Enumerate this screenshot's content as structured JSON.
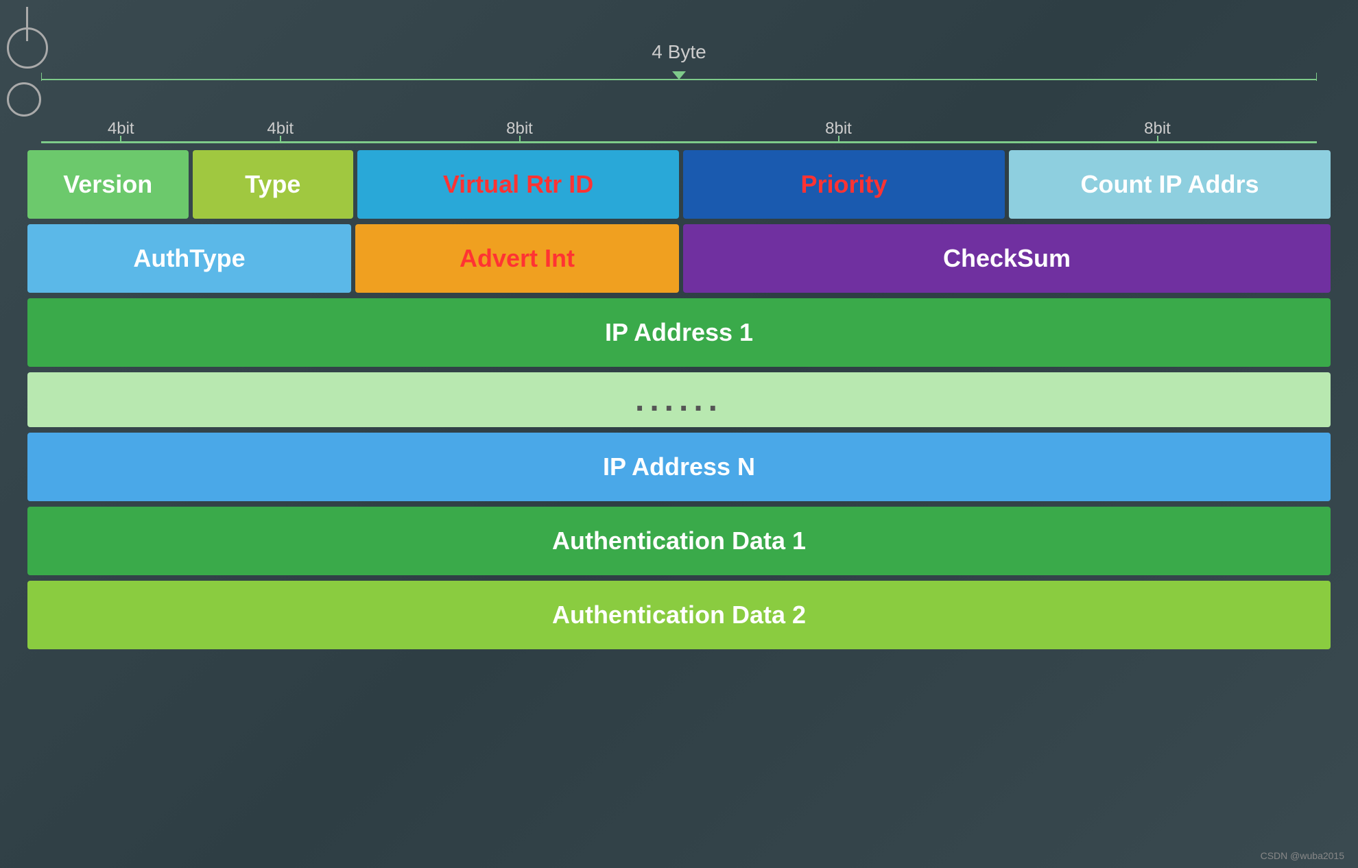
{
  "header": {
    "four_byte_label": "4 Byte",
    "bit_segments": [
      {
        "label": "4bit",
        "flex": 1
      },
      {
        "label": "4bit",
        "flex": 1
      },
      {
        "label": "8bit",
        "flex": 2
      },
      {
        "label": "8bit",
        "flex": 2
      },
      {
        "label": "8bit",
        "flex": 2
      }
    ]
  },
  "rows": [
    {
      "cells": [
        {
          "label": "Version",
          "color": "#6cc96c",
          "flex": 1,
          "textColor": "white"
        },
        {
          "label": "Type",
          "color": "#a0c840",
          "flex": 1,
          "textColor": "white"
        },
        {
          "label": "Virtual Rtr ID",
          "color": "#29a8d8",
          "flex": 2,
          "textColor": "red"
        },
        {
          "label": "Priority",
          "color": "#1a5aaf",
          "flex": 2,
          "textColor": "red"
        },
        {
          "label": "Count IP Addrs",
          "color": "#8ecfdf",
          "flex": 2,
          "textColor": "white"
        }
      ]
    },
    {
      "cells": [
        {
          "label": "AuthType",
          "color": "#5bb8e8",
          "flex": 2,
          "textColor": "white"
        },
        {
          "label": "Advert Int",
          "color": "#f0a020",
          "flex": 2,
          "textColor": "red"
        },
        {
          "label": "CheckSum",
          "color": "#7030a0",
          "flex": 4,
          "textColor": "white"
        }
      ]
    },
    {
      "cells": [
        {
          "label": "IP Address 1",
          "color": "#3aaa4a",
          "flex": 8,
          "textColor": "white"
        }
      ]
    },
    {
      "cells": [
        {
          "label": "......",
          "color": "#b8e8b0",
          "flex": 8,
          "textColor": "#555555"
        }
      ]
    },
    {
      "cells": [
        {
          "label": "IP Address N",
          "color": "#4aa8e8",
          "flex": 8,
          "textColor": "white"
        }
      ]
    },
    {
      "cells": [
        {
          "label": "Authentication Data 1",
          "color": "#3aaa4a",
          "flex": 8,
          "textColor": "white"
        }
      ]
    },
    {
      "cells": [
        {
          "label": "Authentication Data 2",
          "color": "#8acc40",
          "flex": 8,
          "textColor": "white"
        }
      ]
    }
  ],
  "watermark": "CSDN @wuba2015"
}
